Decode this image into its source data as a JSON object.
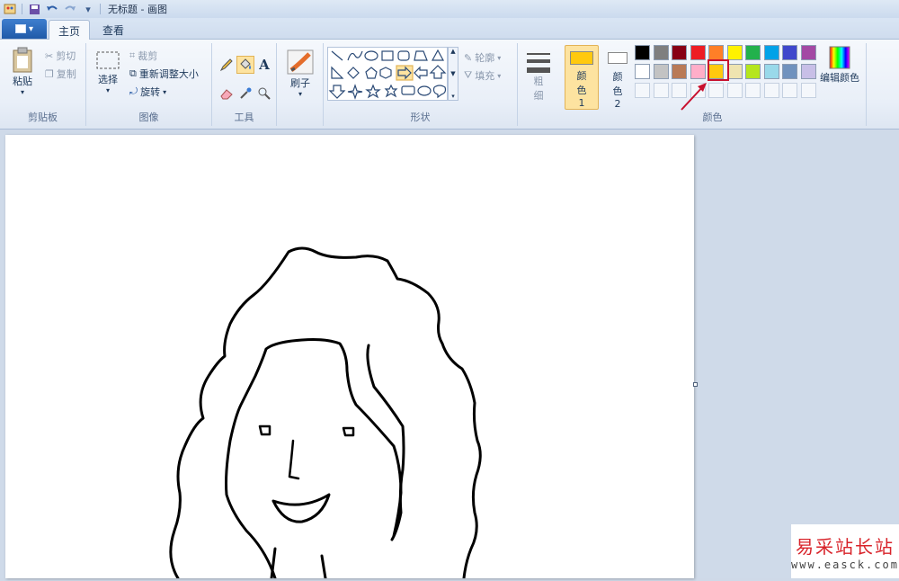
{
  "window": {
    "title": "无标题 - 画图"
  },
  "tabs": {
    "home": "主页",
    "view": "查看"
  },
  "clipboard": {
    "paste": "粘贴",
    "cut": "剪切",
    "copy": "复制",
    "label": "剪贴板"
  },
  "image": {
    "select": "选择",
    "crop": "裁剪",
    "resize": "重新调整大小",
    "rotate": "旋转",
    "label": "图像"
  },
  "tools": {
    "label": "工具"
  },
  "brushes": {
    "label": "刷子"
  },
  "shapes": {
    "outline": "轮廓",
    "fill": "填充",
    "label": "形状"
  },
  "size": {
    "label_1": "粗",
    "label_2": "细"
  },
  "colors": {
    "color1": "颜色 1",
    "color2": "颜色 2",
    "edit": "编辑颜色",
    "label": "颜色",
    "color1_value": "#ffc90e",
    "color2_value": "#ffffff",
    "row1": [
      "#000000",
      "#7f7f7f",
      "#880015",
      "#ed1c24",
      "#ff7f27",
      "#fff200",
      "#22b14c",
      "#00a2e8",
      "#3f48cc",
      "#a349a4"
    ],
    "row2": [
      "#ffffff",
      "#c3c3c3",
      "#b97a57",
      "#ffaec9",
      "#ffc90e",
      "#efe4b0",
      "#b5e61d",
      "#99d9ea",
      "#7092be",
      "#c8bfe7"
    ]
  },
  "watermark": {
    "text": "易采站长站",
    "url": "www.easck.com"
  }
}
